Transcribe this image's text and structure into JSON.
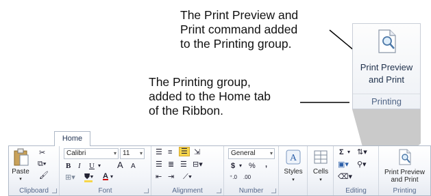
{
  "callouts": {
    "top": [
      "The Print Preview and",
      "Print command added",
      "to the Printing group."
    ],
    "left": [
      "The Printing group,",
      "added to the Home tab",
      "of the Ribbon."
    ]
  },
  "zoomed_group": {
    "button_label_line1": "Print Preview",
    "button_label_line2": "and Print",
    "group_label": "Printing",
    "icon": "print-preview-icon"
  },
  "ribbon": {
    "tab": "Home",
    "clipboard": {
      "label": "Clipboard",
      "paste": "Paste"
    },
    "font": {
      "label": "Font",
      "font_name": "Calibri",
      "font_size": "11",
      "bold": "B",
      "italic": "I",
      "underline": "U",
      "grow": "A",
      "shrink": "A",
      "font_color": "A"
    },
    "alignment": {
      "label": "Alignment"
    },
    "number": {
      "label": "Number",
      "format": "General",
      "currency": "$",
      "percent": "%",
      "comma": ","
    },
    "styles": {
      "label": "Styles"
    },
    "cells": {
      "label": "Cells"
    },
    "editing": {
      "label": "Editing",
      "sum": "Σ"
    },
    "printing": {
      "label": "Printing",
      "button_line1": "Print Preview",
      "button_line2": "and Print"
    }
  },
  "colors": {
    "accent": "#4f6485",
    "highlight": "#f7d64a",
    "font_color": "#d00000"
  }
}
